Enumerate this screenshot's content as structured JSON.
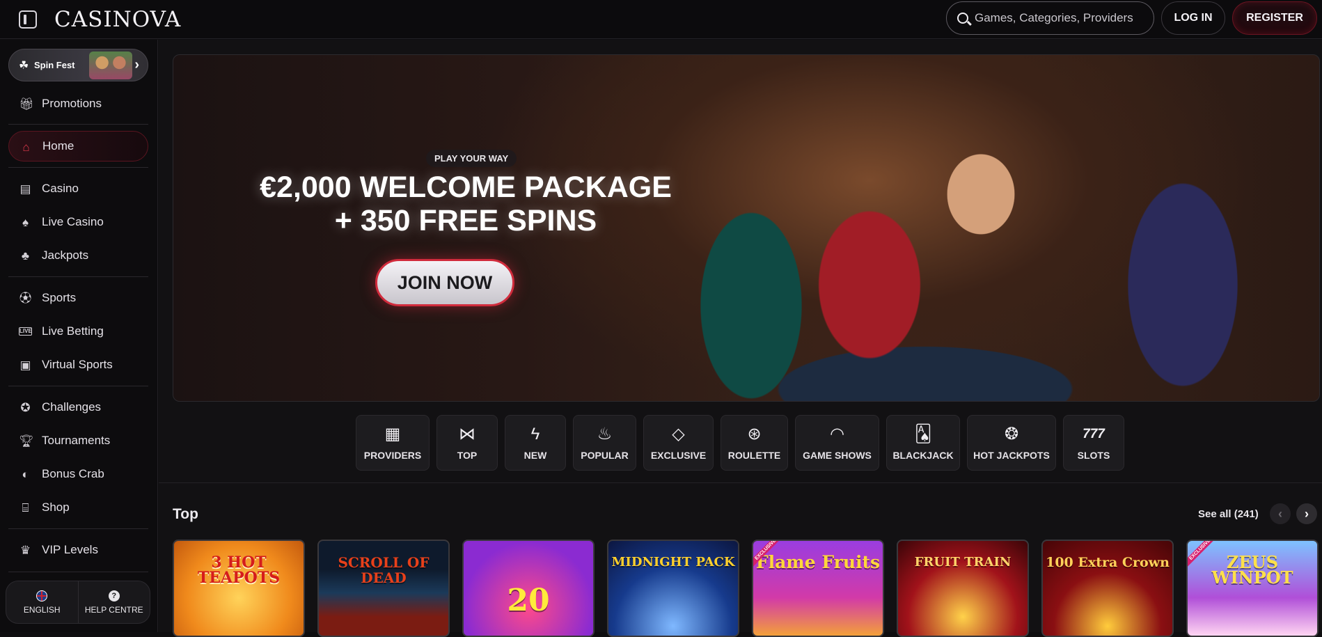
{
  "header": {
    "logo": "CASINOVA",
    "search_placeholder": "Games, Categories, Providers",
    "login_label": "LOG IN",
    "register_label": "REGISTER"
  },
  "sidebar": {
    "promo_label": "Spin Fest",
    "items": [
      {
        "label": "Promotions",
        "icon": "gift-icon"
      },
      {
        "label": "Home",
        "icon": "home-icon"
      },
      {
        "label": "Casino",
        "icon": "slot-machine-icon"
      },
      {
        "label": "Live Casino",
        "icon": "live-casino-icon"
      },
      {
        "label": "Jackpots",
        "icon": "clover-icon"
      },
      {
        "label": "Sports",
        "icon": "soccer-ball-icon"
      },
      {
        "label": "Live Betting",
        "icon": "live-badge-icon"
      },
      {
        "label": "Virtual Sports",
        "icon": "virtual-sports-icon"
      },
      {
        "label": "Challenges",
        "icon": "medal-icon"
      },
      {
        "label": "Tournaments",
        "icon": "trophy-icon"
      },
      {
        "label": "Bonus Crab",
        "icon": "crab-claw-icon"
      },
      {
        "label": "Shop",
        "icon": "shop-icon"
      },
      {
        "label": "VIP Levels",
        "icon": "crown-icon"
      }
    ],
    "language_label": "ENGLISH",
    "help_label": "HELP CENTRE"
  },
  "hero": {
    "tag": "PLAY YOUR WAY",
    "title_line1": "€2,000 WELCOME PACKAGE",
    "title_line2": "+ 350 FREE SPINS",
    "cta_label": "JOIN NOW"
  },
  "categories": [
    {
      "label": "PROVIDERS",
      "icon": "providers-icon"
    },
    {
      "label": "TOP",
      "icon": "bow-tie-icon"
    },
    {
      "label": "NEW",
      "icon": "lightning-icon"
    },
    {
      "label": "POPULAR",
      "icon": "flame-icon"
    },
    {
      "label": "EXCLUSIVE",
      "icon": "diamond-icon"
    },
    {
      "label": "ROULETTE",
      "icon": "roulette-icon"
    },
    {
      "label": "GAME SHOWS",
      "icon": "mask-icon"
    },
    {
      "label": "BLACKJACK",
      "icon": "cards-icon"
    },
    {
      "label": "HOT JACKPOTS",
      "icon": "hot-jackpot-icon"
    },
    {
      "label": "SLOTS",
      "icon": "777-icon"
    }
  ],
  "top_section": {
    "title": "Top",
    "see_all_label": "See all (241)"
  },
  "games": [
    {
      "title": "3 HOT TEAPOTS",
      "exclusive": false
    },
    {
      "title": "SCROLL OF DEAD",
      "exclusive": false
    },
    {
      "title": "20",
      "exclusive": false
    },
    {
      "title": "MIDNIGHT PACK",
      "exclusive": false
    },
    {
      "title": "Flame Fruits",
      "exclusive": true
    },
    {
      "title": "FRUIT TRAIN",
      "exclusive": false
    },
    {
      "title": "100 Extra Crown",
      "exclusive": false
    },
    {
      "title": "ZEUS WINPOT",
      "exclusive": true
    }
  ],
  "exclusive_badge": "EXCLUSIVE",
  "colors": {
    "accent": "#d12b3c",
    "background": "#121113",
    "sidebar": "#0d0c0e"
  }
}
